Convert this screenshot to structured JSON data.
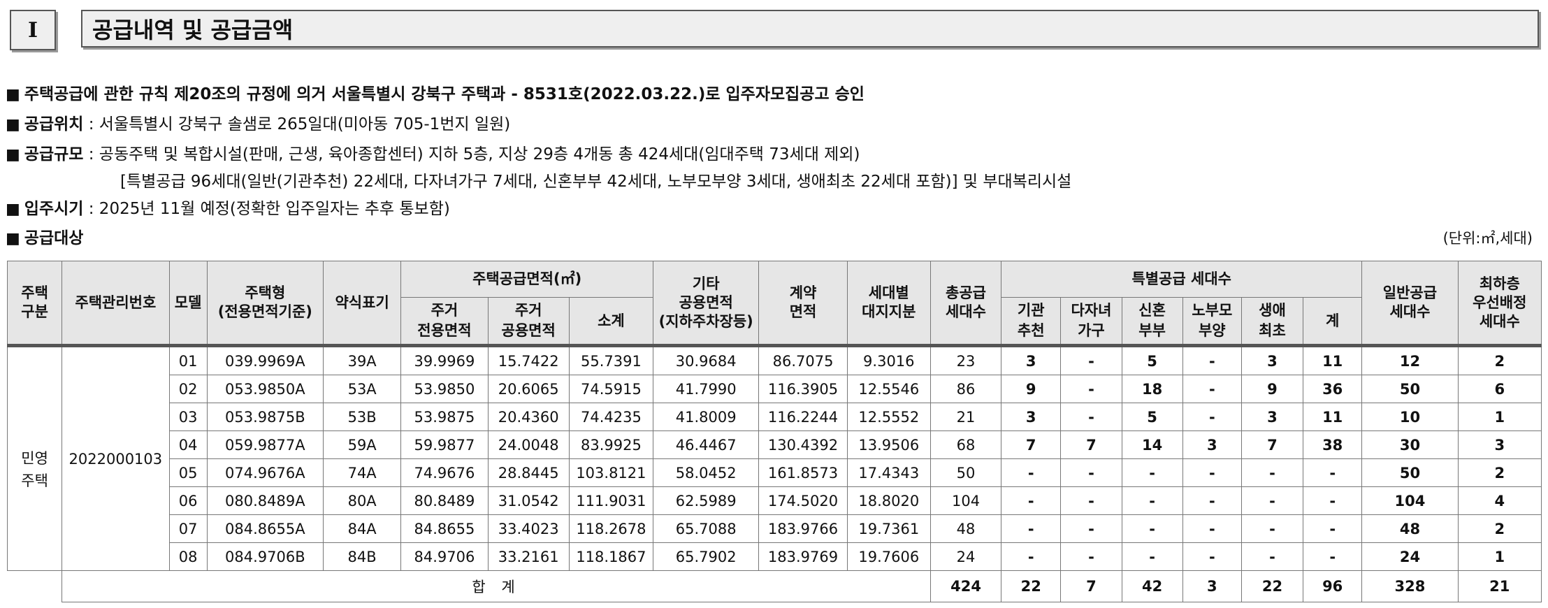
{
  "section": {
    "numeral": "I",
    "title": "공급내역 및 공급금액"
  },
  "info": {
    "line1": "주택공급에 관한 규칙 제20조의 규정에 의거 서울특별시 강북구 주택과 - 8531호(2022.03.22.)로 입주자모집공고 승인",
    "location_label": "공급위치",
    "location_value": " : 서울특별시 강북구 솔샘로 265일대(미아동 705-1번지 일원)",
    "scale_label": "공급규모",
    "scale_value": " : 공동주택 및 복합시설(판매, 근생, 육아종합센터) 지하 5층, 지상 29층 4개동 총 424세대(임대주택 73세대 제외)",
    "scale_value2": "[특별공급 96세대(일반(기관추천) 22세대, 다자녀가구 7세대, 신혼부부 42세대, 노부모부양 3세대, 생애최초 22세대 포함)] 및 부대복리시설",
    "move_label": "입주시기",
    "move_value": " : 2025년 11월 예정(정확한 입주일자는 추후 통보함)",
    "target_label": "공급대상",
    "unit_note": "(단위:㎡,세대)"
  },
  "table": {
    "headers": {
      "housing_type": "주택\n구분",
      "mgmt_no": "주택관리번호",
      "model": "모델",
      "house_type": "주택형\n(전용면적기준)",
      "abbr": "약식표기",
      "supply_area": "주택공급면적(㎡)",
      "exclusive": "주거\n전용면적",
      "common": "주거\n공용면적",
      "subtotal": "소계",
      "other_common": "기타\n공용면적\n(지하주차장등)",
      "contract_area": "계약\n면적",
      "land_share": "세대별\n대지지분",
      "total_units": "총공급\n세대수",
      "special": "특별공급 세대수",
      "institution": "기관\n추천",
      "multichild": "다자녀\n가구",
      "newlywed": "신혼\n부부",
      "elderly": "노부모\n부양",
      "first_life": "생애\n최초",
      "special_sum": "계",
      "general": "일반공급\n세대수",
      "lowest_floor": "최하층\n우선배정\n세대수"
    },
    "category": "민영\n주택",
    "mgmt_number": "2022000103",
    "rows": [
      {
        "model": "01",
        "type": "039.9969A",
        "abbr": "39A",
        "excl": "39.9969",
        "comm": "15.7422",
        "sub": "55.7391",
        "other": "30.9684",
        "contract": "86.7075",
        "land": "9.3016",
        "total": "23",
        "inst": "3",
        "multi": "-",
        "newly": "5",
        "elder": "-",
        "first": "3",
        "ssum": "11",
        "general": "12",
        "lowest": "2"
      },
      {
        "model": "02",
        "type": "053.9850A",
        "abbr": "53A",
        "excl": "53.9850",
        "comm": "20.6065",
        "sub": "74.5915",
        "other": "41.7990",
        "contract": "116.3905",
        "land": "12.5546",
        "total": "86",
        "inst": "9",
        "multi": "-",
        "newly": "18",
        "elder": "-",
        "first": "9",
        "ssum": "36",
        "general": "50",
        "lowest": "6"
      },
      {
        "model": "03",
        "type": "053.9875B",
        "abbr": "53B",
        "excl": "53.9875",
        "comm": "20.4360",
        "sub": "74.4235",
        "other": "41.8009",
        "contract": "116.2244",
        "land": "12.5552",
        "total": "21",
        "inst": "3",
        "multi": "-",
        "newly": "5",
        "elder": "-",
        "first": "3",
        "ssum": "11",
        "general": "10",
        "lowest": "1"
      },
      {
        "model": "04",
        "type": "059.9877A",
        "abbr": "59A",
        "excl": "59.9877",
        "comm": "24.0048",
        "sub": "83.9925",
        "other": "46.4467",
        "contract": "130.4392",
        "land": "13.9506",
        "total": "68",
        "inst": "7",
        "multi": "7",
        "newly": "14",
        "elder": "3",
        "first": "7",
        "ssum": "38",
        "general": "30",
        "lowest": "3"
      },
      {
        "model": "05",
        "type": "074.9676A",
        "abbr": "74A",
        "excl": "74.9676",
        "comm": "28.8445",
        "sub": "103.8121",
        "other": "58.0452",
        "contract": "161.8573",
        "land": "17.4343",
        "total": "50",
        "inst": "-",
        "multi": "-",
        "newly": "-",
        "elder": "-",
        "first": "-",
        "ssum": "-",
        "general": "50",
        "lowest": "2"
      },
      {
        "model": "06",
        "type": "080.8489A",
        "abbr": "80A",
        "excl": "80.8489",
        "comm": "31.0542",
        "sub": "111.9031",
        "other": "62.5989",
        "contract": "174.5020",
        "land": "18.8020",
        "total": "104",
        "inst": "-",
        "multi": "-",
        "newly": "-",
        "elder": "-",
        "first": "-",
        "ssum": "-",
        "general": "104",
        "lowest": "4"
      },
      {
        "model": "07",
        "type": "084.8655A",
        "abbr": "84A",
        "excl": "84.8655",
        "comm": "33.4023",
        "sub": "118.2678",
        "other": "65.7088",
        "contract": "183.9766",
        "land": "19.7361",
        "total": "48",
        "inst": "-",
        "multi": "-",
        "newly": "-",
        "elder": "-",
        "first": "-",
        "ssum": "-",
        "general": "48",
        "lowest": "2"
      },
      {
        "model": "08",
        "type": "084.9706B",
        "abbr": "84B",
        "excl": "84.9706",
        "comm": "33.2161",
        "sub": "118.1867",
        "other": "65.7902",
        "contract": "183.9769",
        "land": "19.7606",
        "total": "24",
        "inst": "-",
        "multi": "-",
        "newly": "-",
        "elder": "-",
        "first": "-",
        "ssum": "-",
        "general": "24",
        "lowest": "1"
      }
    ],
    "totals": {
      "label": "합 계",
      "total": "424",
      "inst": "22",
      "multi": "7",
      "newly": "42",
      "elder": "3",
      "first": "22",
      "ssum": "96",
      "general": "328",
      "lowest": "21"
    }
  }
}
